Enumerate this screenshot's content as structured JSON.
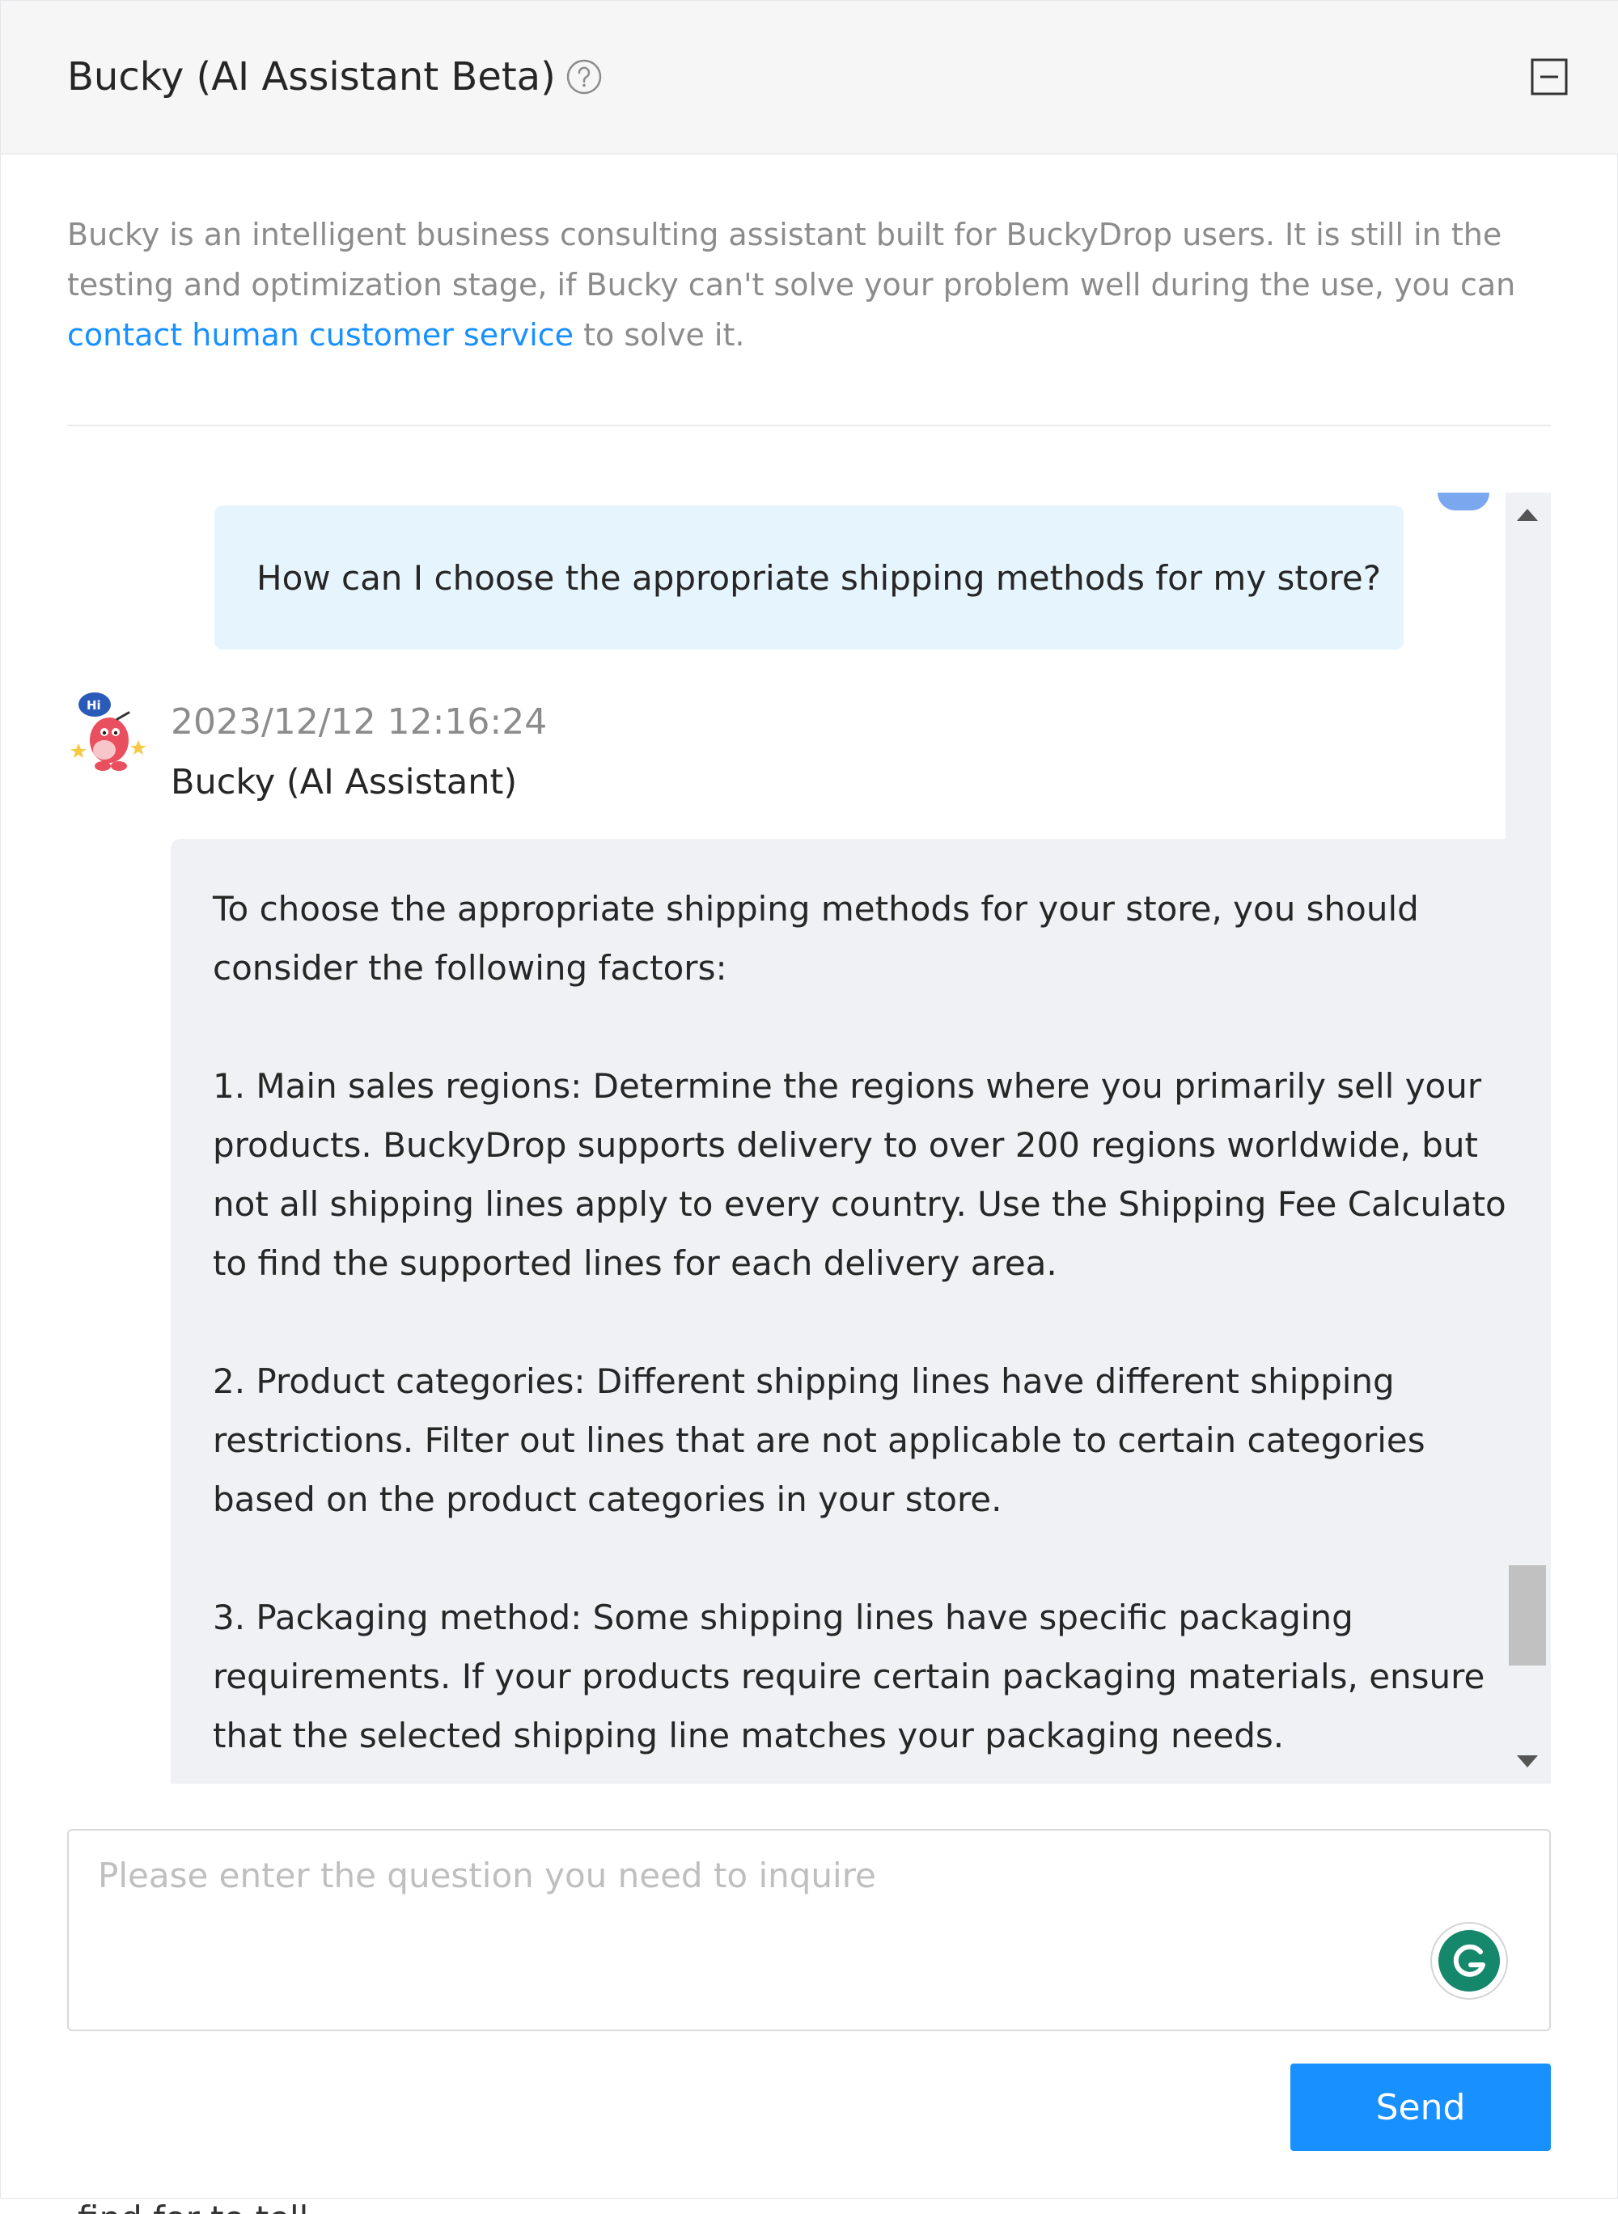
{
  "header": {
    "title": "Bucky (AI Assistant Beta)",
    "help_icon": "question-circle-icon",
    "minimize_icon": "minimize-icon"
  },
  "intro": {
    "text_before": "Bucky is an intelligent business consulting assistant built for BuckyDrop users. It is still in the testing and optimization stage, if Bucky can't solve your problem well during the use, you can ",
    "link": "contact human customer service",
    "text_after": " to solve it."
  },
  "conversation": {
    "user_message": "How can I choose the appropriate shipping methods for my store?",
    "bot": {
      "timestamp": "2023/12/12 12:16:24",
      "name": "Bucky (AI Assistant)",
      "paragraphs": [
        "To choose the appropriate shipping methods for your store, you should consider the following factors:",
        "1. Main sales regions: Determine the regions where you primarily sell your products. BuckyDrop supports delivery to over 200 regions worldwide, but not all shipping lines apply to every country. Use the Shipping Fee Calculator to find the supported lines for each delivery area.",
        "2. Product categories: Different shipping lines have different shipping restrictions. Filter out lines that are not applicable to certain categories based on the product categories in your store.",
        "3. Packaging method: Some shipping lines have specific packaging requirements. If your products require certain packaging materials, ensure that the selected shipping line matches your packaging needs."
      ]
    }
  },
  "composer": {
    "placeholder": "Please enter the question you need to inquire",
    "value": "",
    "send_label": "Send"
  },
  "colors": {
    "accent": "#1890ff",
    "user_bubble": "#e6f4fd",
    "bot_bubble": "#f0f1f4",
    "header_bg": "#f6f6f7"
  }
}
